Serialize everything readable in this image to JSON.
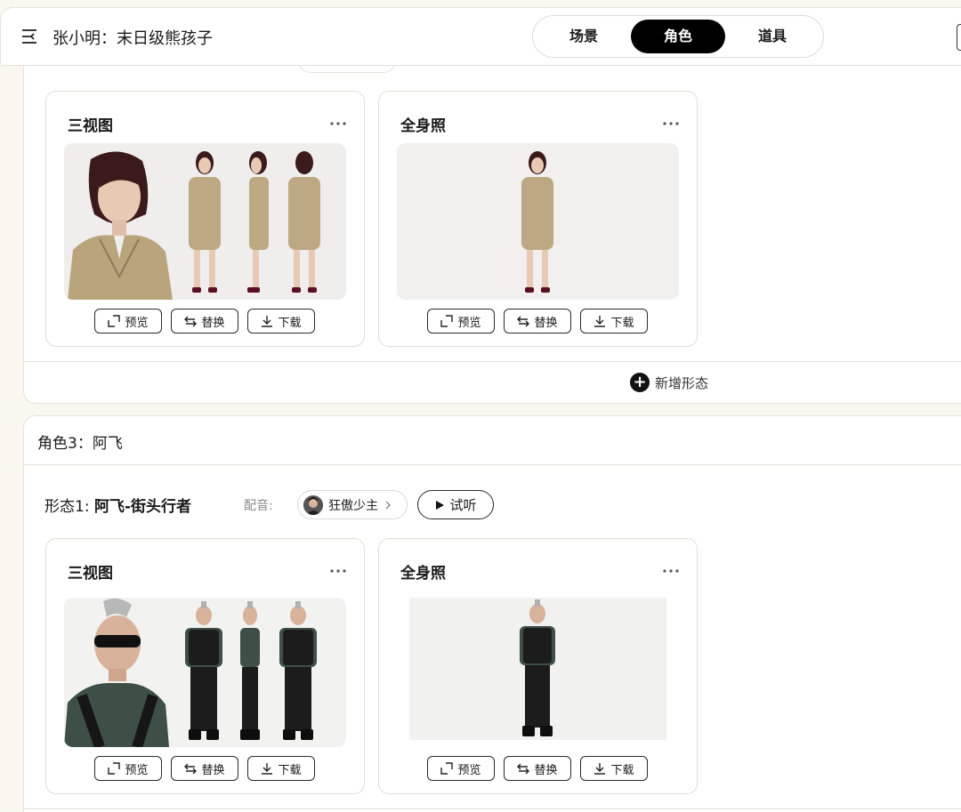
{
  "header": {
    "title": "张小明：末日级熊孩子",
    "tabs": [
      {
        "label": "场景",
        "active": false
      },
      {
        "label": "角色",
        "active": true
      },
      {
        "label": "道具",
        "active": false
      }
    ]
  },
  "section_top": {
    "cards": [
      {
        "title": "三视图",
        "image": "woman-trench-coat-three-view"
      },
      {
        "title": "全身照",
        "image": "woman-trench-coat-full-body"
      }
    ],
    "add_form_label": "新增形态"
  },
  "actions": {
    "preview": "预览",
    "replace": "替换",
    "download": "下载"
  },
  "role3": {
    "heading": "角色3：阿飞",
    "form_prefix": "形态1: ",
    "form_name": "阿飞-街头行者",
    "voice_label": "配音:",
    "voice_name": "狂傲少主",
    "listen_label": "试听",
    "cards": [
      {
        "title": "三视图",
        "image": "punk-man-three-view"
      },
      {
        "title": "全身照",
        "image": "punk-man-full-body"
      }
    ]
  },
  "colors": {
    "accent": "#000000",
    "background": "#faf6f0",
    "card": "#ffffff"
  }
}
